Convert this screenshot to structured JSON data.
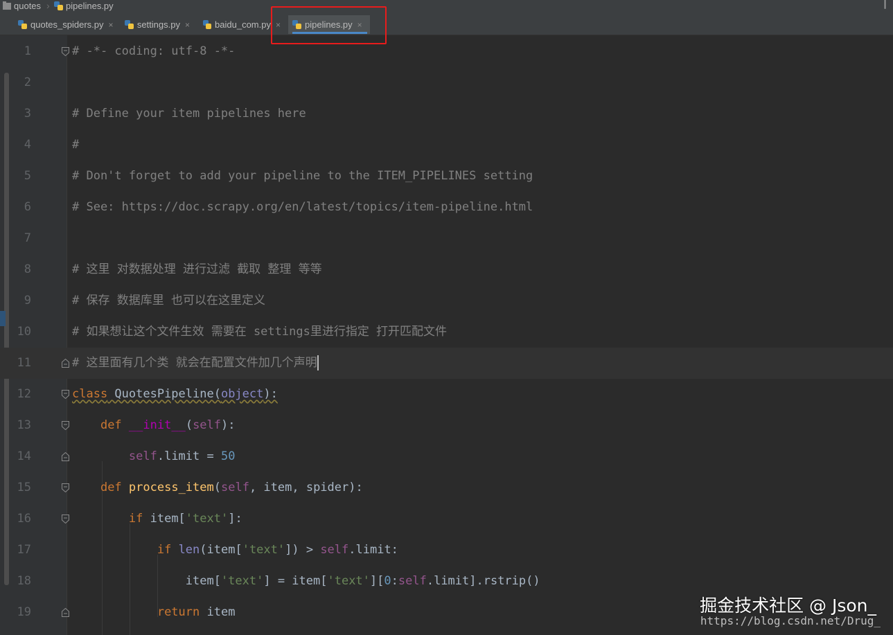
{
  "breadcrumb": {
    "project": "quotes",
    "file": "pipelines.py"
  },
  "tabs": [
    {
      "label": "quotes_spiders.py",
      "active": false
    },
    {
      "label": "settings.py",
      "active": false
    },
    {
      "label": "baidu_com.py",
      "active": false
    },
    {
      "label": "pipelines.py",
      "active": true
    }
  ],
  "close_glyph": "×",
  "colors": {
    "highlight_box": "#e81c1c",
    "keyword": "#cc7832",
    "comment": "#808080",
    "string": "#6a8759",
    "number": "#6897bb",
    "self": "#94558d"
  },
  "editor": {
    "current_line": 11,
    "lines": [
      {
        "no": "1",
        "text": "# -*- coding: utf-8 -*-"
      },
      {
        "no": "2",
        "text": ""
      },
      {
        "no": "3",
        "text": "# Define your item pipelines here"
      },
      {
        "no": "4",
        "text": "#"
      },
      {
        "no": "5",
        "text": "# Don't forget to add your pipeline to the ITEM_PIPELINES setting"
      },
      {
        "no": "6",
        "text": "# See: https://doc.scrapy.org/en/latest/topics/item-pipeline.html"
      },
      {
        "no": "7",
        "text": ""
      },
      {
        "no": "8",
        "text": "# 这里 对数据处理 进行过滤 截取 整理 等等"
      },
      {
        "no": "9",
        "text": "# 保存 数据库里 也可以在这里定义"
      },
      {
        "no": "10",
        "text": "# 如果想让这个文件生效 需要在 settings里进行指定 打开匹配文件"
      },
      {
        "no": "11",
        "text": "# 这里面有几个类 就会在配置文件加几个声明"
      },
      {
        "no": "12",
        "text": "class QuotesPipeline(object):"
      },
      {
        "no": "13",
        "text": "    def __init__(self):"
      },
      {
        "no": "14",
        "text": "        self.limit = 50"
      },
      {
        "no": "15",
        "text": "    def process_item(self, item, spider):"
      },
      {
        "no": "16",
        "text": "        if item['text']:"
      },
      {
        "no": "17",
        "text": "            if len(item['text']) > self.limit:"
      },
      {
        "no": "18",
        "text": "                item['text'] = item['text'][0:self.limit].rstrip()"
      },
      {
        "no": "19",
        "text": "            return item"
      }
    ]
  },
  "watermark": {
    "text": "掘金技术社区 @ Json_",
    "url": "https://blog.csdn.net/Drug_"
  }
}
